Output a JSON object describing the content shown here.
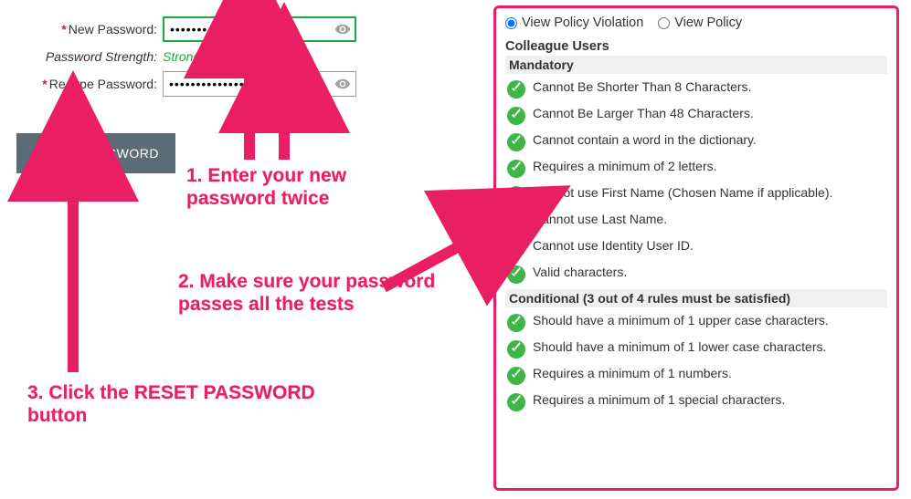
{
  "form": {
    "new_password_label": "New Password:",
    "retype_password_label": "Re-type Password:",
    "strength_label": "Password Strength:",
    "strength_value": "Strong",
    "new_password_value": "••••••••••••••••",
    "retype_password_value": "••••••••••••••••",
    "reset_button": "RESET PASSWORD"
  },
  "policy": {
    "radio_violation": "View Policy Violation",
    "radio_policy": "View Policy",
    "heading": "Colleague Users",
    "mandatory_label": "Mandatory",
    "conditional_label": "Conditional (3 out of 4 rules must be satisfied)",
    "mandatory_rules": [
      "Cannot Be Shorter Than 8 Characters.",
      "Cannot Be Larger Than 48 Characters.",
      "Cannot contain a word in the dictionary.",
      "Requires a minimum of 2 letters.",
      "Cannot use First Name (Chosen Name if applicable).",
      "Cannot use Last Name.",
      "Cannot use Identity User ID.",
      "Valid characters."
    ],
    "conditional_rules": [
      "Should have a minimum of 1 upper case characters.",
      "Should have a minimum of 1 lower case characters.",
      "Requires a minimum of 1 numbers.",
      "Requires a minimum of 1 special characters."
    ]
  },
  "annotations": {
    "step1": "1. Enter your new\npassword twice",
    "step2": "2. Make sure your password\npasses all the tests",
    "step3": "3. Click the RESET PASSWORD\nbutton"
  },
  "colors": {
    "accent_pink": "#e91e63",
    "success_green": "#3fb447",
    "strong_green": "#1aa83a",
    "button_bg": "#5b6c77"
  }
}
